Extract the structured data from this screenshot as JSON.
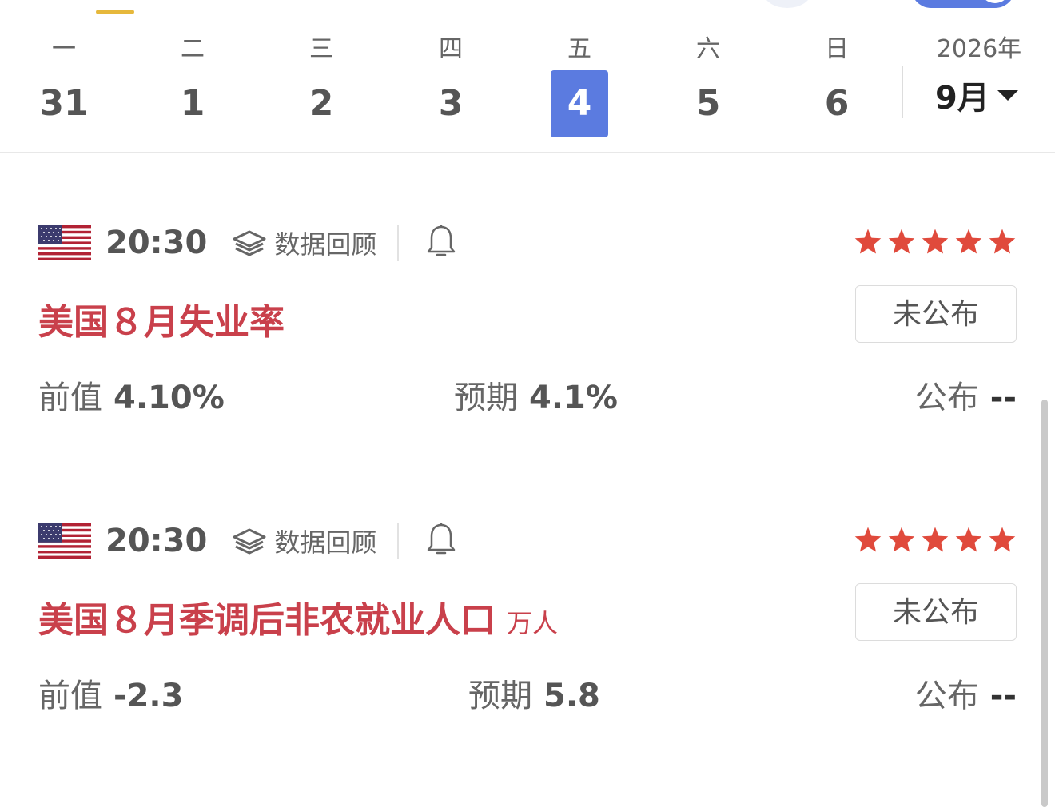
{
  "week": {
    "weekdays": [
      "一",
      "二",
      "三",
      "四",
      "五",
      "六",
      "日"
    ],
    "dates": [
      "31",
      "1",
      "2",
      "3",
      "4",
      "5",
      "6"
    ],
    "active_index": 4,
    "year": "2026年",
    "month": "9月"
  },
  "events": [
    {
      "country": "US",
      "time": "20:30",
      "review_label": "数据回顾",
      "stars": 5,
      "title": "美国８月失业率",
      "unit": "",
      "status": "未公布",
      "prev_label": "前值",
      "prev_value": "4.10%",
      "expected_label": "预期",
      "expected_value": "4.1%",
      "actual_label": "公布",
      "actual_value": "--"
    },
    {
      "country": "US",
      "time": "20:30",
      "review_label": "数据回顾",
      "stars": 5,
      "title": "美国８月季调后非农就业人口",
      "unit": "万人",
      "status": "未公布",
      "prev_label": "前值",
      "prev_value": "-2.3",
      "expected_label": "预期",
      "expected_value": "5.8",
      "actual_label": "公布",
      "actual_value": "--"
    }
  ],
  "colors": {
    "accent": "#5b7be0",
    "title_red": "#c9404b",
    "star_red": "#e04a3c",
    "tab_indicator": "#e6b83c"
  },
  "icons": [
    "us-flag-icon",
    "layers-icon",
    "bell-icon",
    "star-icon",
    "caret-down-icon"
  ]
}
